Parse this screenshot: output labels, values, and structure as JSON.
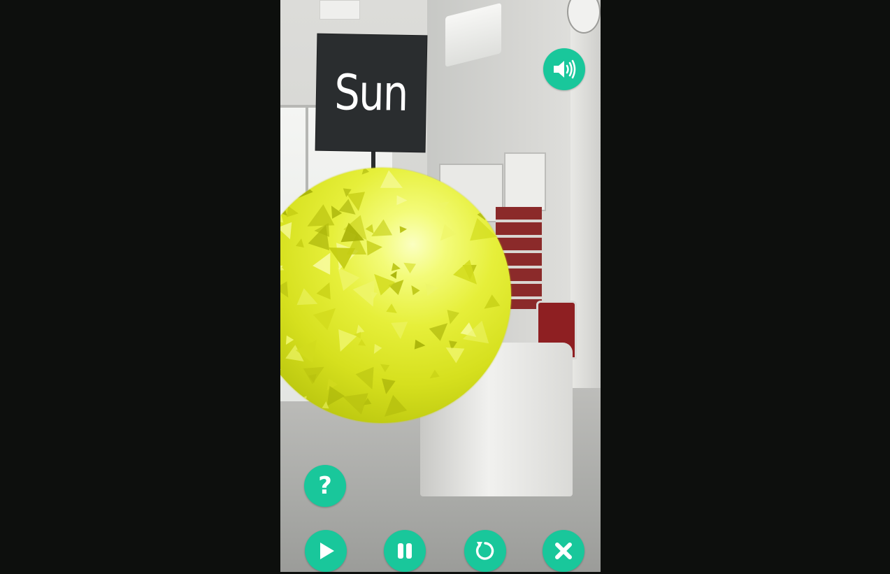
{
  "sign": {
    "label": "Sun"
  },
  "controls": {
    "help_label": "?",
    "colors": {
      "button": "#19c79b",
      "icon": "#ffffff"
    },
    "icons": [
      "speaker-icon",
      "question-icon",
      "play-icon",
      "pause-icon",
      "replay-icon",
      "close-icon"
    ]
  },
  "planet": {
    "color": "#e6ef3a"
  }
}
